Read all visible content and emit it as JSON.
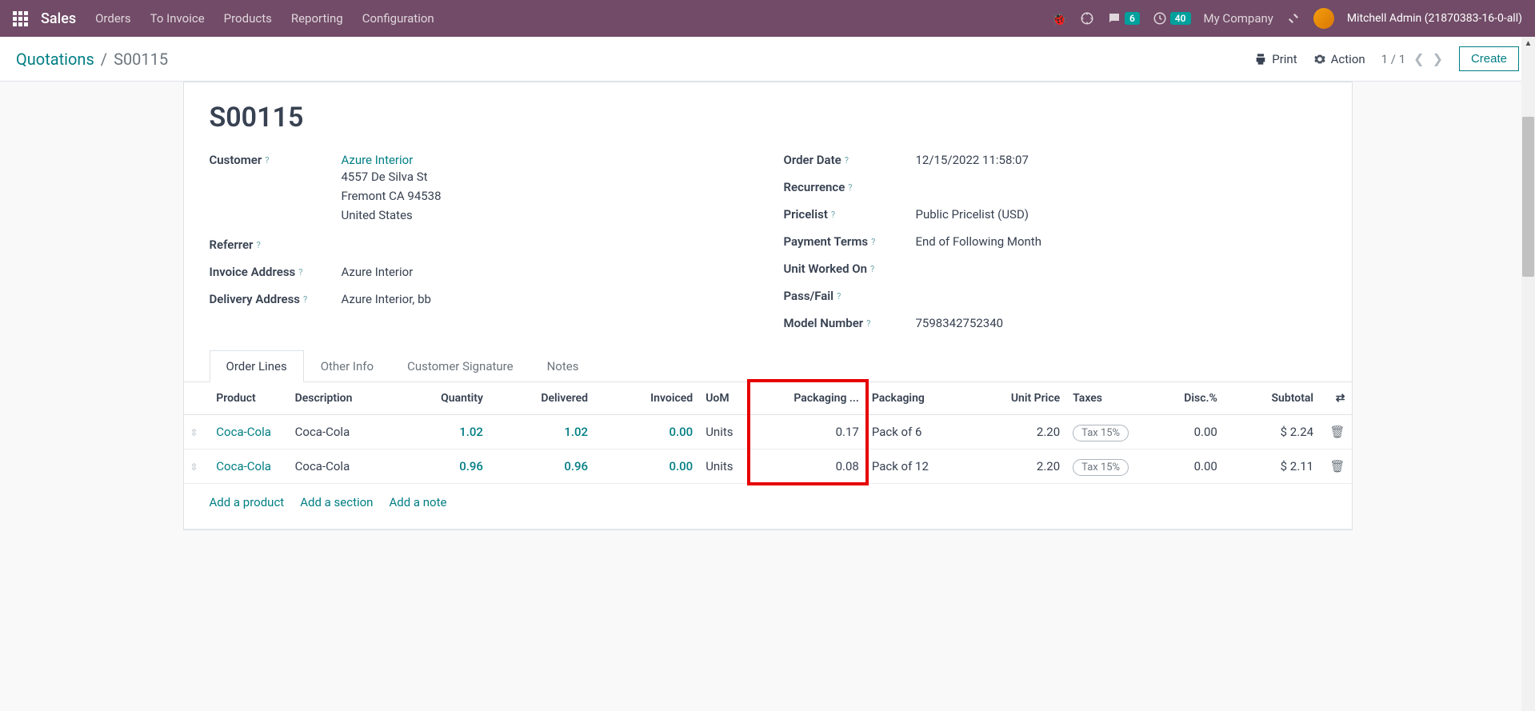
{
  "navbar": {
    "brand": "Sales",
    "links": [
      "Orders",
      "To Invoice",
      "Products",
      "Reporting",
      "Configuration"
    ],
    "messages_badge": "6",
    "activities_badge": "40",
    "company": "My Company",
    "user": "Mitchell Admin (21870383-16-0-all)"
  },
  "breadcrumb": {
    "parent": "Quotations",
    "current": "S00115"
  },
  "controls": {
    "print": "Print",
    "action": "Action",
    "pager": "1 / 1",
    "create": "Create"
  },
  "record": {
    "title": "S00115"
  },
  "fields": {
    "customer_label": "Customer",
    "customer_name": "Azure Interior",
    "customer_addr1": "4557 De Silva St",
    "customer_addr2": "Fremont CA 94538",
    "customer_addr3": "United States",
    "referrer_label": "Referrer",
    "invoice_addr_label": "Invoice Address",
    "invoice_addr": "Azure Interior",
    "delivery_addr_label": "Delivery Address",
    "delivery_addr": "Azure Interior, bb",
    "order_date_label": "Order Date",
    "order_date": "12/15/2022 11:58:07",
    "recurrence_label": "Recurrence",
    "pricelist_label": "Pricelist",
    "pricelist": "Public Pricelist (USD)",
    "payment_terms_label": "Payment Terms",
    "payment_terms": "End of Following Month",
    "unit_worked_label": "Unit Worked On",
    "pass_fail_label": "Pass/Fail",
    "model_number_label": "Model Number",
    "model_number": "7598342752340"
  },
  "tabs": [
    "Order Lines",
    "Other Info",
    "Customer Signature",
    "Notes"
  ],
  "columns": {
    "product": "Product",
    "description": "Description",
    "quantity": "Quantity",
    "delivered": "Delivered",
    "invoiced": "Invoiced",
    "uom": "UoM",
    "packaging_qty": "Packaging ...",
    "packaging": "Packaging",
    "unit_price": "Unit Price",
    "taxes": "Taxes",
    "disc": "Disc.%",
    "subtotal": "Subtotal"
  },
  "lines": [
    {
      "product": "Coca-Cola",
      "description": "Coca-Cola",
      "quantity": "1.02",
      "delivered": "1.02",
      "invoiced": "0.00",
      "uom": "Units",
      "packaging_qty": "0.17",
      "packaging": "Pack of 6",
      "unit_price": "2.20",
      "tax": "Tax 15%",
      "disc": "0.00",
      "subtotal": "$ 2.24"
    },
    {
      "product": "Coca-Cola",
      "description": "Coca-Cola",
      "quantity": "0.96",
      "delivered": "0.96",
      "invoiced": "0.00",
      "uom": "Units",
      "packaging_qty": "0.08",
      "packaging": "Pack of 12",
      "unit_price": "2.20",
      "tax": "Tax 15%",
      "disc": "0.00",
      "subtotal": "$ 2.11"
    }
  ],
  "add_actions": {
    "product": "Add a product",
    "section": "Add a section",
    "note": "Add a note"
  }
}
